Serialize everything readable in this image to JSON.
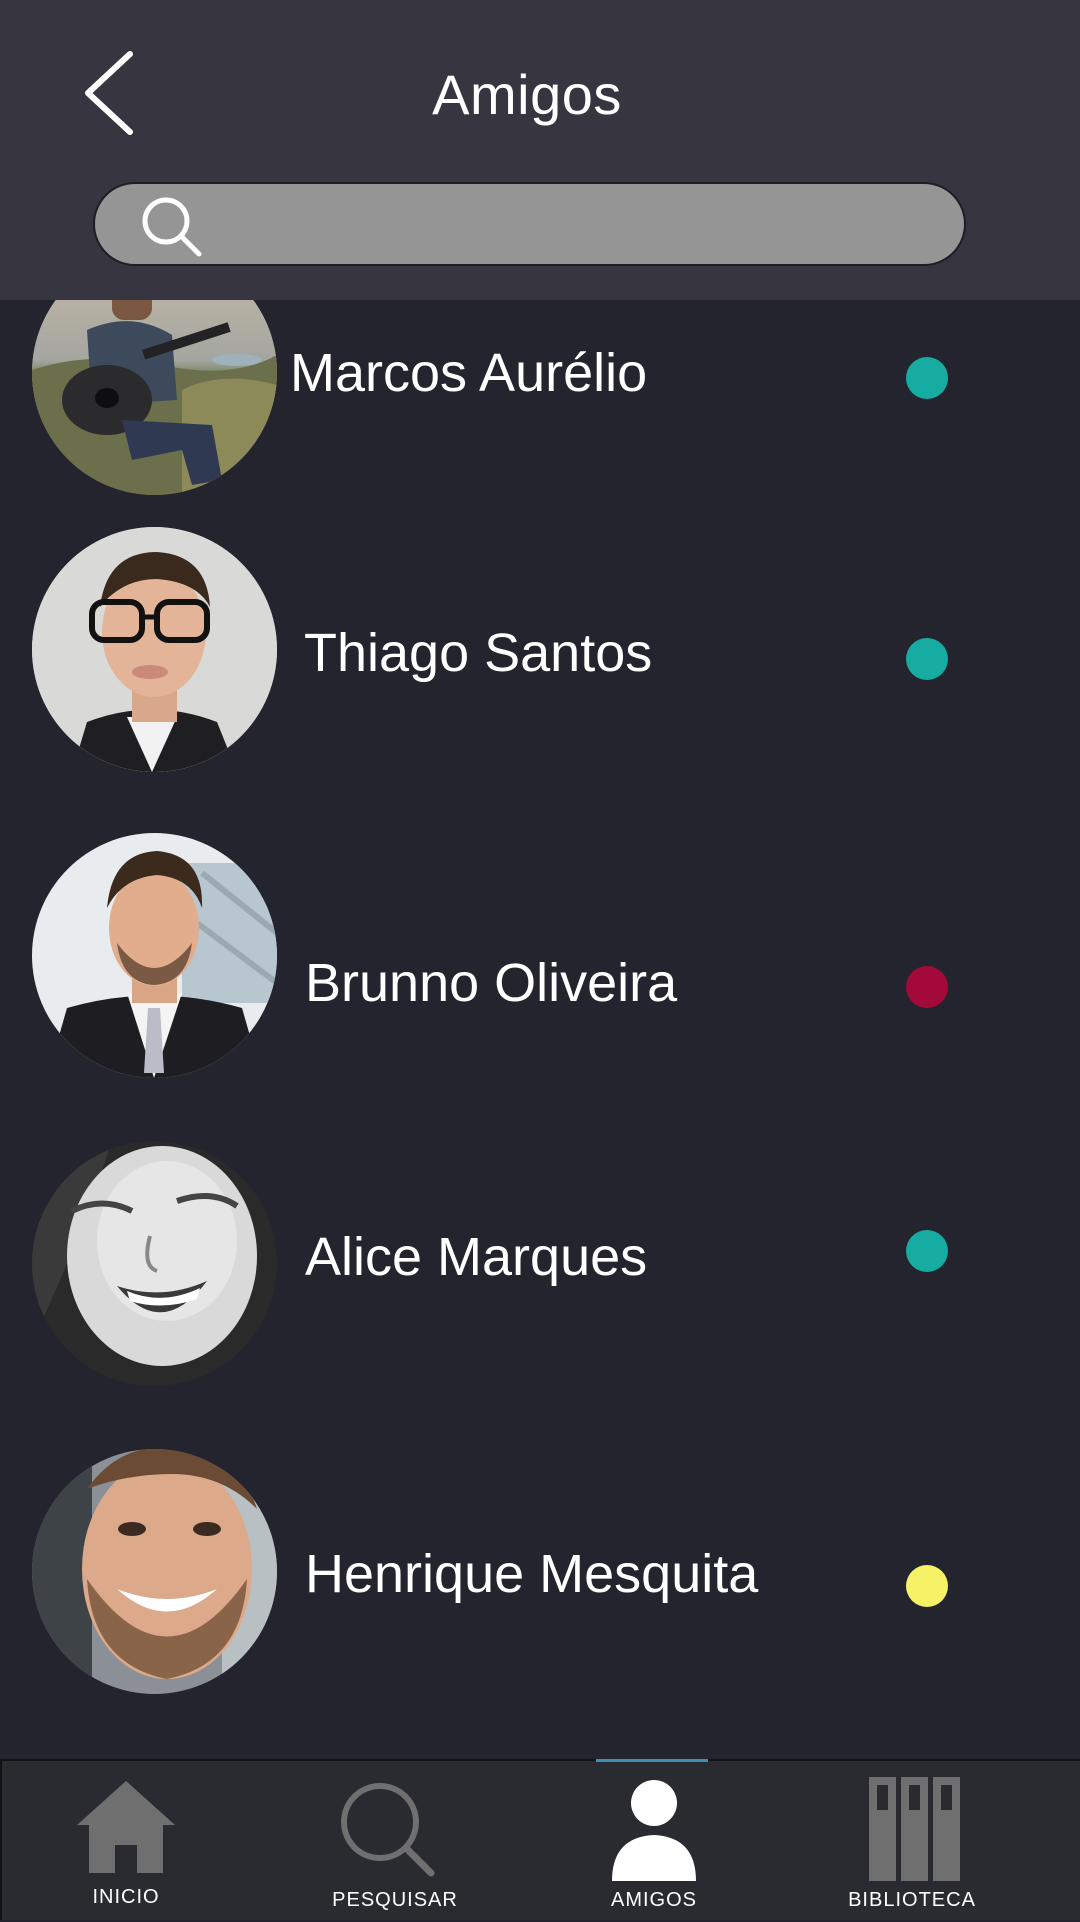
{
  "header": {
    "title": "Amigos",
    "back_icon": "chevron-left-icon"
  },
  "search": {
    "placeholder": "",
    "value": "",
    "icon": "search-icon"
  },
  "friends": [
    {
      "name": "Marcos Aurélio",
      "status_color": "#17aca2"
    },
    {
      "name": "Thiago Santos",
      "status_color": "#17aca2"
    },
    {
      "name": "Brunno Oliveira",
      "status_color": "#a30a3a"
    },
    {
      "name": "Alice Marques",
      "status_color": "#17aca2"
    },
    {
      "name": "Henrique Mesquita",
      "status_color": "#f5f266"
    }
  ],
  "nav": {
    "items": [
      {
        "label": "INICIO",
        "icon": "home-icon"
      },
      {
        "label": "PESQUISAR",
        "icon": "search-icon"
      },
      {
        "label": "AMIGOS",
        "icon": "user-icon"
      },
      {
        "label": "BIBLIOTECA",
        "icon": "library-icon"
      }
    ],
    "active_index": 2,
    "accent_color": "#3f8fb0"
  },
  "colors": {
    "background": "#24242f",
    "header_background": "#373640",
    "search_background": "#959595",
    "nav_background": "#2a2b31",
    "icon_gray": "#6f6f6f"
  }
}
